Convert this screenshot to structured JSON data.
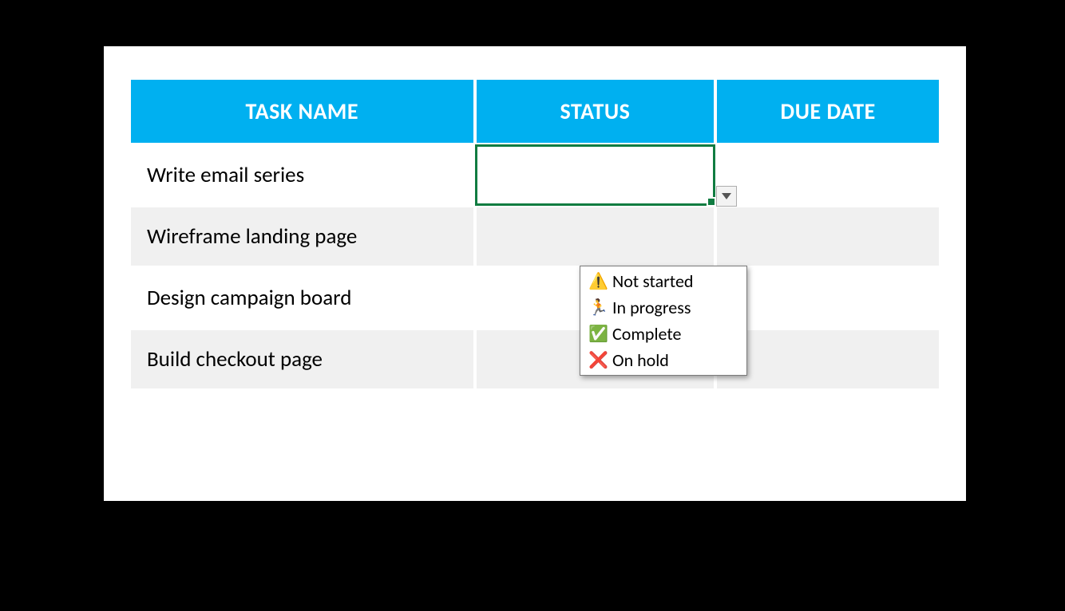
{
  "headers": {
    "task": "TASK NAME",
    "status": "STATUS",
    "due": "DUE DATE"
  },
  "rows": [
    {
      "task": "Write email series",
      "status": "",
      "due": ""
    },
    {
      "task": "Wireframe landing page",
      "status": "",
      "due": ""
    },
    {
      "task": "Design campaign board",
      "status": "",
      "due": ""
    },
    {
      "task": "Build checkout page",
      "status": "",
      "due": ""
    }
  ],
  "dropdown_options": [
    {
      "icon": "⚠️",
      "label": "Not started"
    },
    {
      "icon": "🏃",
      "label": "In progress"
    },
    {
      "icon": "✅",
      "label": "Complete"
    },
    {
      "icon": "❌",
      "label": "On hold"
    }
  ]
}
